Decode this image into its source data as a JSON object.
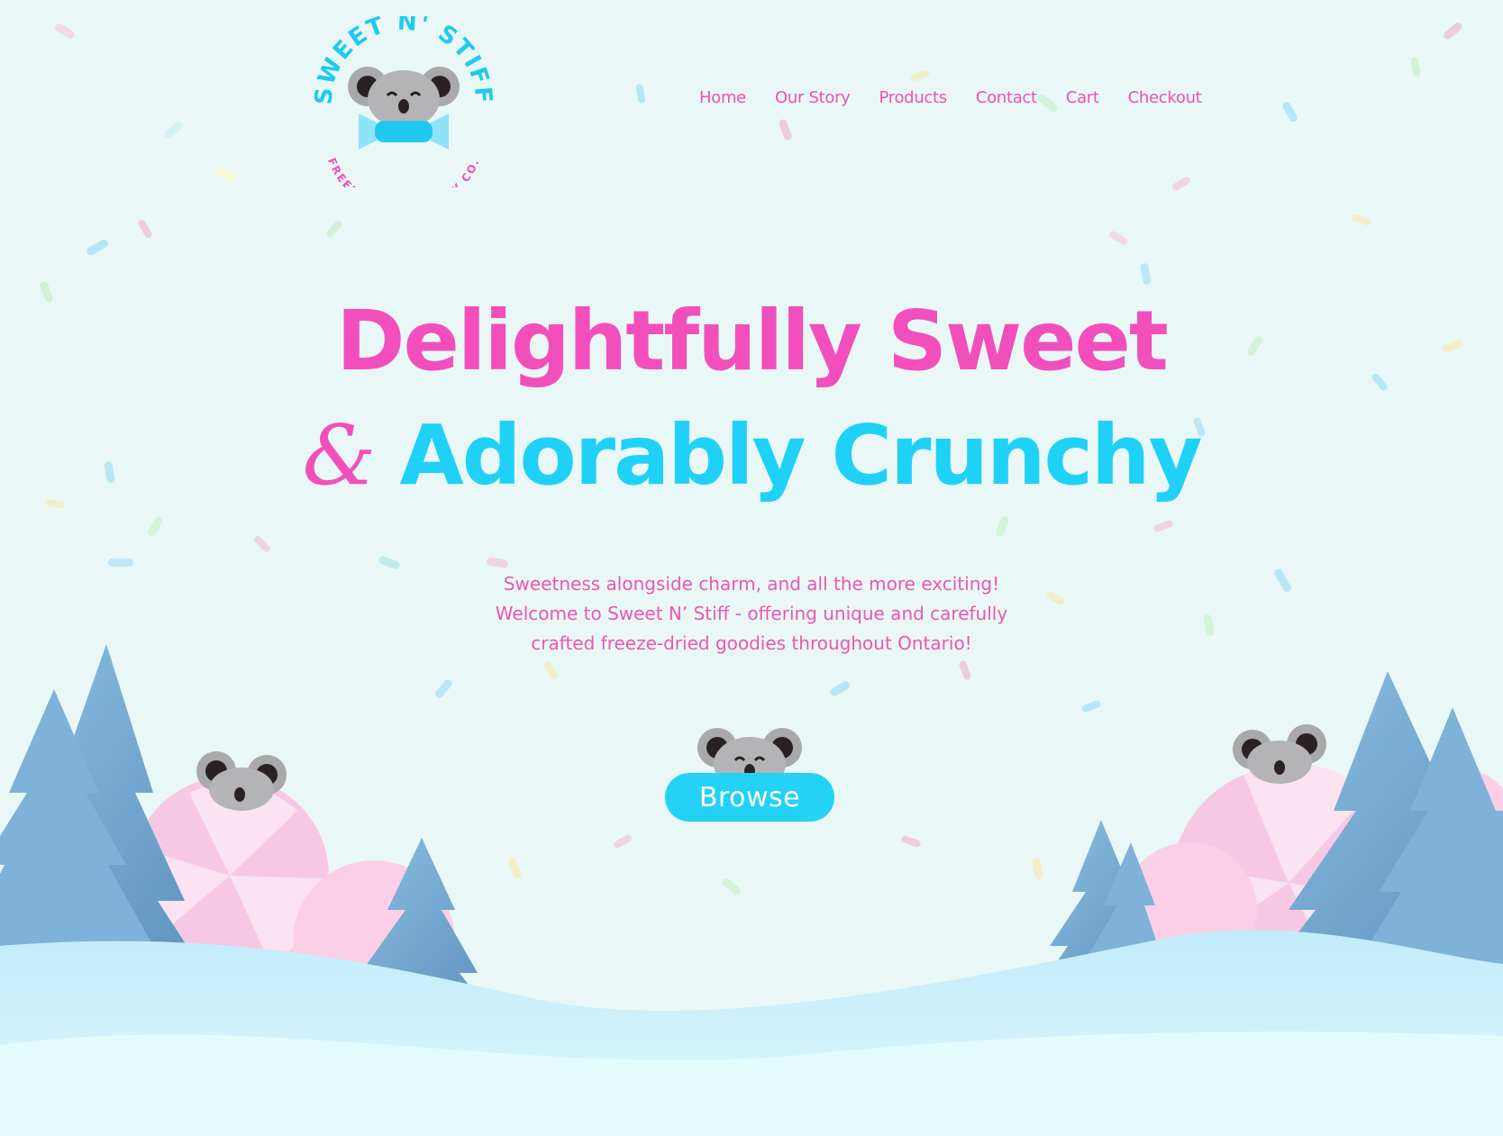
{
  "brand": {
    "name_arc": "SWEET N' STIFF",
    "sub_arc": "FREEZE DRIED CANDY CO."
  },
  "nav": {
    "items": [
      {
        "label": "Home"
      },
      {
        "label": "Our Story"
      },
      {
        "label": "Products"
      },
      {
        "label": "Contact"
      },
      {
        "label": "Cart"
      },
      {
        "label": "Checkout"
      }
    ]
  },
  "hero": {
    "line1": "Delightfully Sweet",
    "ampersand": "&",
    "line2": "Adorably Crunchy",
    "tagline": [
      "Sweetness alongside charm, and all the more exciting!",
      "Welcome to Sweet N’ Stiff - offering unique and carefully",
      "crafted freeze-dried goodies throughout Ontario!"
    ],
    "cta_label": "Browse"
  },
  "colors": {
    "background": "#e9f8f6",
    "pink": "#f24fbd",
    "cyan": "#1fd1f7",
    "tree": "#6ea5cf",
    "snow": "#e3fbfd"
  }
}
